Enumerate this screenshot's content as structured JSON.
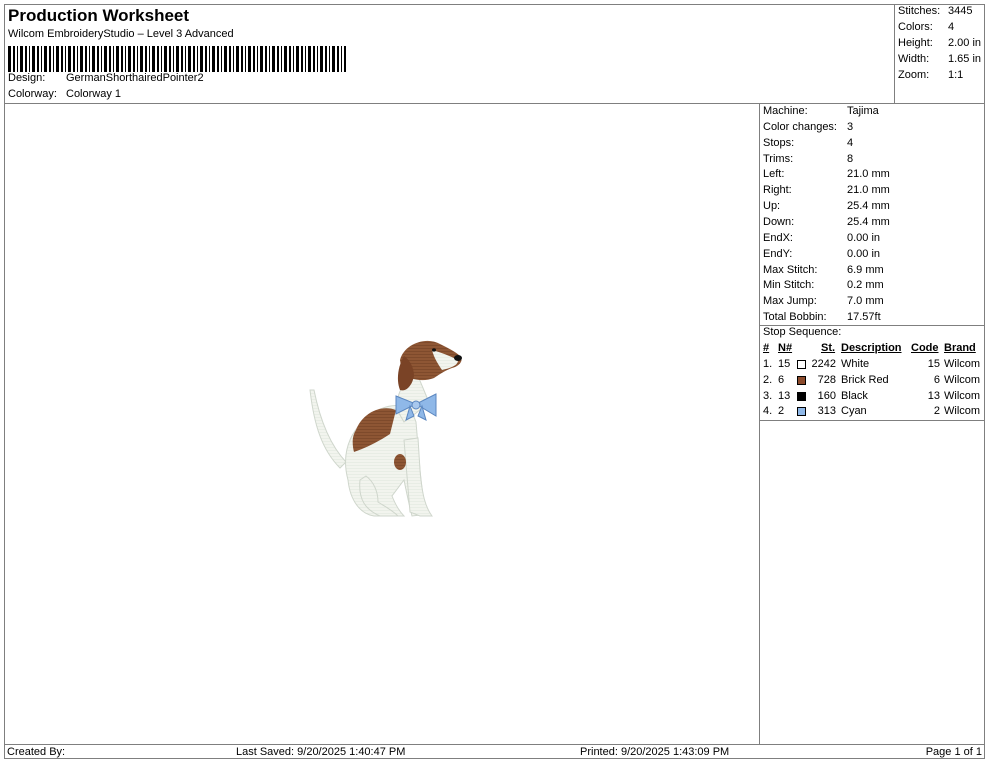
{
  "header": {
    "title": "Production Worksheet",
    "subtitle": "Wilcom EmbroideryStudio – Level 3 Advanced",
    "design_label": "Design:",
    "design_value": "GermanShorthairedPointer2",
    "colorway_label": "Colorway:",
    "colorway_value": "Colorway 1"
  },
  "stats": [
    {
      "key": "Stitches:",
      "value": "3445"
    },
    {
      "key": "Colors:",
      "value": "4"
    },
    {
      "key": "Height:",
      "value": "2.00 in"
    },
    {
      "key": "Width:",
      "value": "1.65 in"
    },
    {
      "key": "Zoom:",
      "value": "1:1"
    }
  ],
  "machine_info": [
    {
      "key": "Machine:",
      "value": "Tajima"
    },
    {
      "key": "Color changes:",
      "value": "3"
    },
    {
      "key": "Stops:",
      "value": "4"
    },
    {
      "key": "Trims:",
      "value": "8"
    },
    {
      "key": "Left:",
      "value": "21.0 mm"
    },
    {
      "key": "Right:",
      "value": "21.0 mm"
    },
    {
      "key": "Up:",
      "value": "25.4 mm"
    },
    {
      "key": "Down:",
      "value": "25.4 mm"
    },
    {
      "key": "EndX:",
      "value": "0.00 in"
    },
    {
      "key": "EndY:",
      "value": "0.00 in"
    },
    {
      "key": "Max Stitch:",
      "value": "6.9 mm"
    },
    {
      "key": "Min Stitch:",
      "value": "0.2 mm"
    },
    {
      "key": "Max Jump:",
      "value": "7.0 mm"
    },
    {
      "key": "Total Bobbin:",
      "value": "17.57ft"
    }
  ],
  "stop_sequence": {
    "title": "Stop Sequence:",
    "headers": {
      "num": "#",
      "n": "N#",
      "st": "St.",
      "desc": "Description",
      "code": "Code",
      "brand": "Brand"
    },
    "rows": [
      {
        "num": "1.",
        "n": "15",
        "color": "#ffffff",
        "st": "2242",
        "desc": "White",
        "code": "15",
        "brand": "Wilcom"
      },
      {
        "num": "2.",
        "n": "6",
        "color": "#8b4a2b",
        "st": "728",
        "desc": "Brick Red",
        "code": "6",
        "brand": "Wilcom"
      },
      {
        "num": "3.",
        "n": "13",
        "color": "#000000",
        "st": "160",
        "desc": "Black",
        "code": "13",
        "brand": "Wilcom"
      },
      {
        "num": "4.",
        "n": "2",
        "color": "#8fb8e8",
        "st": "313",
        "desc": "Cyan",
        "code": "2",
        "brand": "Wilcom"
      }
    ]
  },
  "footer": {
    "created_by": "Created By:",
    "last_saved": "Last Saved: 9/20/2025 1:40:47 PM",
    "printed": "Printed: 9/20/2025 1:43:09 PM",
    "page": "Page 1 of 1"
  }
}
